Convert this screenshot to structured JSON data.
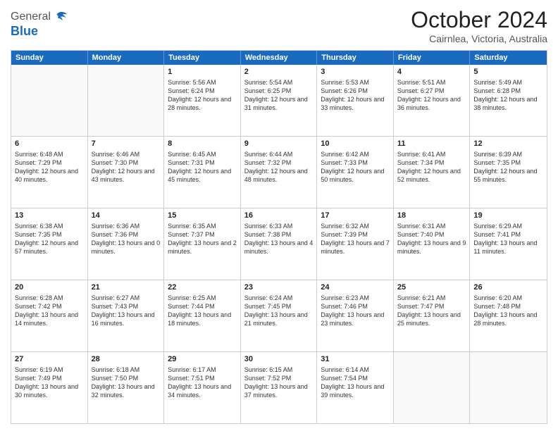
{
  "logo": {
    "line1": "General",
    "line2": "Blue"
  },
  "title": "October 2024",
  "subtitle": "Cairnlea, Victoria, Australia",
  "header_days": [
    "Sunday",
    "Monday",
    "Tuesday",
    "Wednesday",
    "Thursday",
    "Friday",
    "Saturday"
  ],
  "weeks": [
    [
      {
        "day": "",
        "info": "",
        "empty": true
      },
      {
        "day": "",
        "info": "",
        "empty": true
      },
      {
        "day": "1",
        "info": "Sunrise: 5:56 AM\nSunset: 6:24 PM\nDaylight: 12 hours and 28 minutes."
      },
      {
        "day": "2",
        "info": "Sunrise: 5:54 AM\nSunset: 6:25 PM\nDaylight: 12 hours and 31 minutes."
      },
      {
        "day": "3",
        "info": "Sunrise: 5:53 AM\nSunset: 6:26 PM\nDaylight: 12 hours and 33 minutes."
      },
      {
        "day": "4",
        "info": "Sunrise: 5:51 AM\nSunset: 6:27 PM\nDaylight: 12 hours and 36 minutes."
      },
      {
        "day": "5",
        "info": "Sunrise: 5:49 AM\nSunset: 6:28 PM\nDaylight: 12 hours and 38 minutes."
      }
    ],
    [
      {
        "day": "6",
        "info": "Sunrise: 6:48 AM\nSunset: 7:29 PM\nDaylight: 12 hours and 40 minutes."
      },
      {
        "day": "7",
        "info": "Sunrise: 6:46 AM\nSunset: 7:30 PM\nDaylight: 12 hours and 43 minutes."
      },
      {
        "day": "8",
        "info": "Sunrise: 6:45 AM\nSunset: 7:31 PM\nDaylight: 12 hours and 45 minutes."
      },
      {
        "day": "9",
        "info": "Sunrise: 6:44 AM\nSunset: 7:32 PM\nDaylight: 12 hours and 48 minutes."
      },
      {
        "day": "10",
        "info": "Sunrise: 6:42 AM\nSunset: 7:33 PM\nDaylight: 12 hours and 50 minutes."
      },
      {
        "day": "11",
        "info": "Sunrise: 6:41 AM\nSunset: 7:34 PM\nDaylight: 12 hours and 52 minutes."
      },
      {
        "day": "12",
        "info": "Sunrise: 6:39 AM\nSunset: 7:35 PM\nDaylight: 12 hours and 55 minutes."
      }
    ],
    [
      {
        "day": "13",
        "info": "Sunrise: 6:38 AM\nSunset: 7:35 PM\nDaylight: 12 hours and 57 minutes."
      },
      {
        "day": "14",
        "info": "Sunrise: 6:36 AM\nSunset: 7:36 PM\nDaylight: 13 hours and 0 minutes."
      },
      {
        "day": "15",
        "info": "Sunrise: 6:35 AM\nSunset: 7:37 PM\nDaylight: 13 hours and 2 minutes."
      },
      {
        "day": "16",
        "info": "Sunrise: 6:33 AM\nSunset: 7:38 PM\nDaylight: 13 hours and 4 minutes."
      },
      {
        "day": "17",
        "info": "Sunrise: 6:32 AM\nSunset: 7:39 PM\nDaylight: 13 hours and 7 minutes."
      },
      {
        "day": "18",
        "info": "Sunrise: 6:31 AM\nSunset: 7:40 PM\nDaylight: 13 hours and 9 minutes."
      },
      {
        "day": "19",
        "info": "Sunrise: 6:29 AM\nSunset: 7:41 PM\nDaylight: 13 hours and 11 minutes."
      }
    ],
    [
      {
        "day": "20",
        "info": "Sunrise: 6:28 AM\nSunset: 7:42 PM\nDaylight: 13 hours and 14 minutes."
      },
      {
        "day": "21",
        "info": "Sunrise: 6:27 AM\nSunset: 7:43 PM\nDaylight: 13 hours and 16 minutes."
      },
      {
        "day": "22",
        "info": "Sunrise: 6:25 AM\nSunset: 7:44 PM\nDaylight: 13 hours and 18 minutes."
      },
      {
        "day": "23",
        "info": "Sunrise: 6:24 AM\nSunset: 7:45 PM\nDaylight: 13 hours and 21 minutes."
      },
      {
        "day": "24",
        "info": "Sunrise: 6:23 AM\nSunset: 7:46 PM\nDaylight: 13 hours and 23 minutes."
      },
      {
        "day": "25",
        "info": "Sunrise: 6:21 AM\nSunset: 7:47 PM\nDaylight: 13 hours and 25 minutes."
      },
      {
        "day": "26",
        "info": "Sunrise: 6:20 AM\nSunset: 7:48 PM\nDaylight: 13 hours and 28 minutes."
      }
    ],
    [
      {
        "day": "27",
        "info": "Sunrise: 6:19 AM\nSunset: 7:49 PM\nDaylight: 13 hours and 30 minutes."
      },
      {
        "day": "28",
        "info": "Sunrise: 6:18 AM\nSunset: 7:50 PM\nDaylight: 13 hours and 32 minutes."
      },
      {
        "day": "29",
        "info": "Sunrise: 6:17 AM\nSunset: 7:51 PM\nDaylight: 13 hours and 34 minutes."
      },
      {
        "day": "30",
        "info": "Sunrise: 6:15 AM\nSunset: 7:52 PM\nDaylight: 13 hours and 37 minutes."
      },
      {
        "day": "31",
        "info": "Sunrise: 6:14 AM\nSunset: 7:54 PM\nDaylight: 13 hours and 39 minutes."
      },
      {
        "day": "",
        "info": "",
        "empty": true
      },
      {
        "day": "",
        "info": "",
        "empty": true
      }
    ]
  ]
}
